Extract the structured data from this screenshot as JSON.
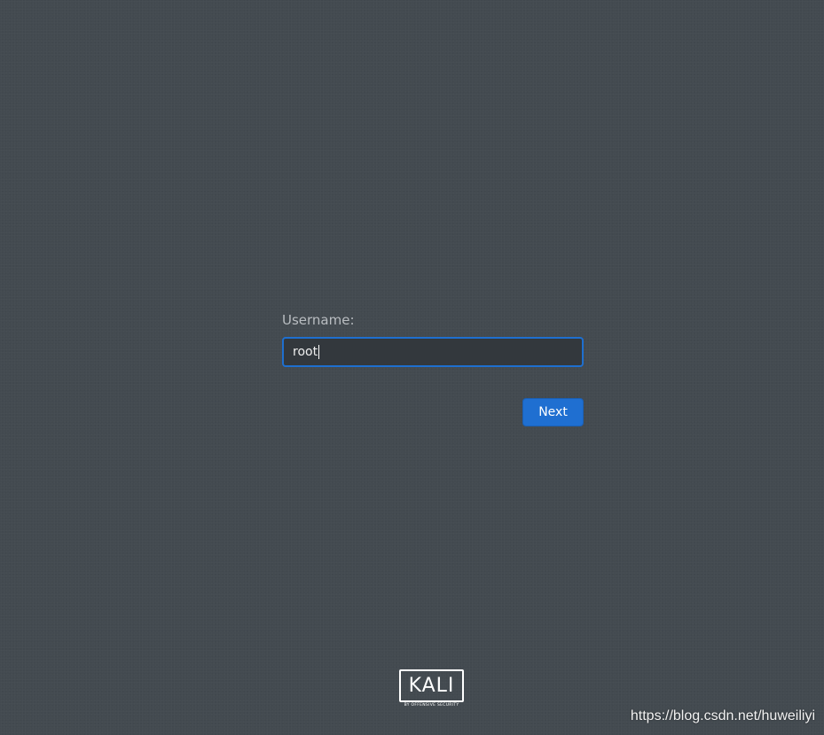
{
  "login": {
    "username_label": "Username:",
    "username_value": "root",
    "next_label": "Next"
  },
  "branding": {
    "logo_text": "KALI",
    "logo_tagline": "BY OFFENSIVE SECURITY"
  },
  "watermark": "https://blog.csdn.net/huweiliyi",
  "colors": {
    "background": "#434a50",
    "accent": "#1f6fd1",
    "field_background": "#33383d"
  }
}
